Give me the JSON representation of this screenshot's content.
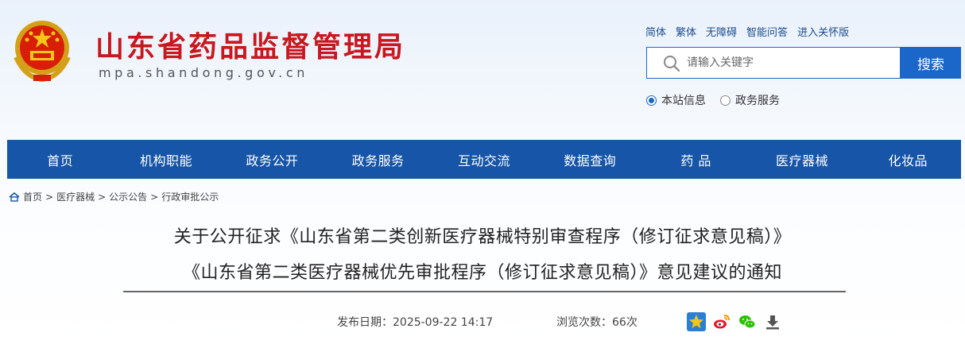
{
  "header": {
    "site_title": "山东省药品监督管理局",
    "site_domain": "mpa.shandong.gov.cn",
    "top_links": [
      "简体",
      "繁体",
      "无障碍",
      "智能问答",
      "进入关怀版"
    ],
    "search": {
      "placeholder": "请输入关键字",
      "value": "",
      "button_label": "搜索"
    },
    "search_scope": [
      {
        "label": "本站信息",
        "checked": true
      },
      {
        "label": "政务服务",
        "checked": false
      }
    ]
  },
  "nav": {
    "items": [
      "首页",
      "机构职能",
      "政务公开",
      "政务服务",
      "互动交流",
      "数据查询",
      "药 品",
      "医疗器械",
      "化妆品"
    ]
  },
  "breadcrumb": {
    "items": [
      "首页",
      "医疗器械",
      "公示公告",
      "行政审批公示"
    ],
    "separator": ">"
  },
  "article": {
    "title_line1": "关于公开征求《山东省第二类创新医疗器械特别审查程序（修订征求意见稿）》",
    "title_line2": "《山东省第二类医疗器械优先审批程序（修订征求意见稿）》意见建议的通知",
    "publish_date": "发布日期：2025-09-22 14:17",
    "view_count": "浏览次数：66次"
  },
  "share_icons": [
    "favorite-star-icon",
    "weibo-icon",
    "wechat-icon",
    "download-icon"
  ],
  "colors": {
    "brand_red": "#c8171e",
    "nav_blue": "#1655a7",
    "search_blue": "#1b66c9"
  }
}
